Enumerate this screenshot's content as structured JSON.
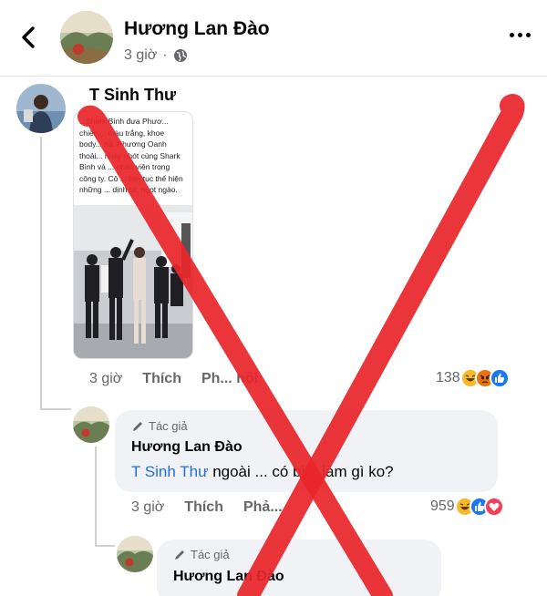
{
  "header": {
    "name": "Hương Lan Đào",
    "time": "3 giờ",
    "back_icon": "chevron-left-icon",
    "more_icon": "more-dots-icon",
    "audience_icon": "globe-icon"
  },
  "comment1": {
    "name": "T Sinh Thư",
    "image_caption": "...Shark Bình đưa Phươ... chiếc ... màu trắng, khoe body... nả. Phương Oanh thoải... nhảy nhót cùng Shark Bình và ... nhân viên trong công ty. Cô ... liên tục thể hiện những ... dịnh tứ, ngọt ngào.",
    "time": "3 giờ",
    "like_label": "Thích",
    "reply_label": "Ph... hồi",
    "reaction_count": "138"
  },
  "reply1": {
    "author_tag": "Tác giả",
    "name": "Hương Lan Đào",
    "mention": "T Sinh Thư",
    "text": " ngoài ... có biết làm gì ko?",
    "time": "3 giờ",
    "like_label": "Thích",
    "reply_label": "Phả...",
    "reaction_count": "959"
  },
  "reply2": {
    "author_tag": "Tác giả",
    "name": "Hương Lan Đào"
  },
  "colors": {
    "mention": "#216fdb",
    "secondary_text": "#65676b",
    "bubble_bg": "#f0f2f5",
    "overlay_red": "#e8262b",
    "like_blue": "#1877f2",
    "haha_yellow": "#f7b928",
    "angry_orange": "#e9710f",
    "love_red": "#f33e58"
  }
}
